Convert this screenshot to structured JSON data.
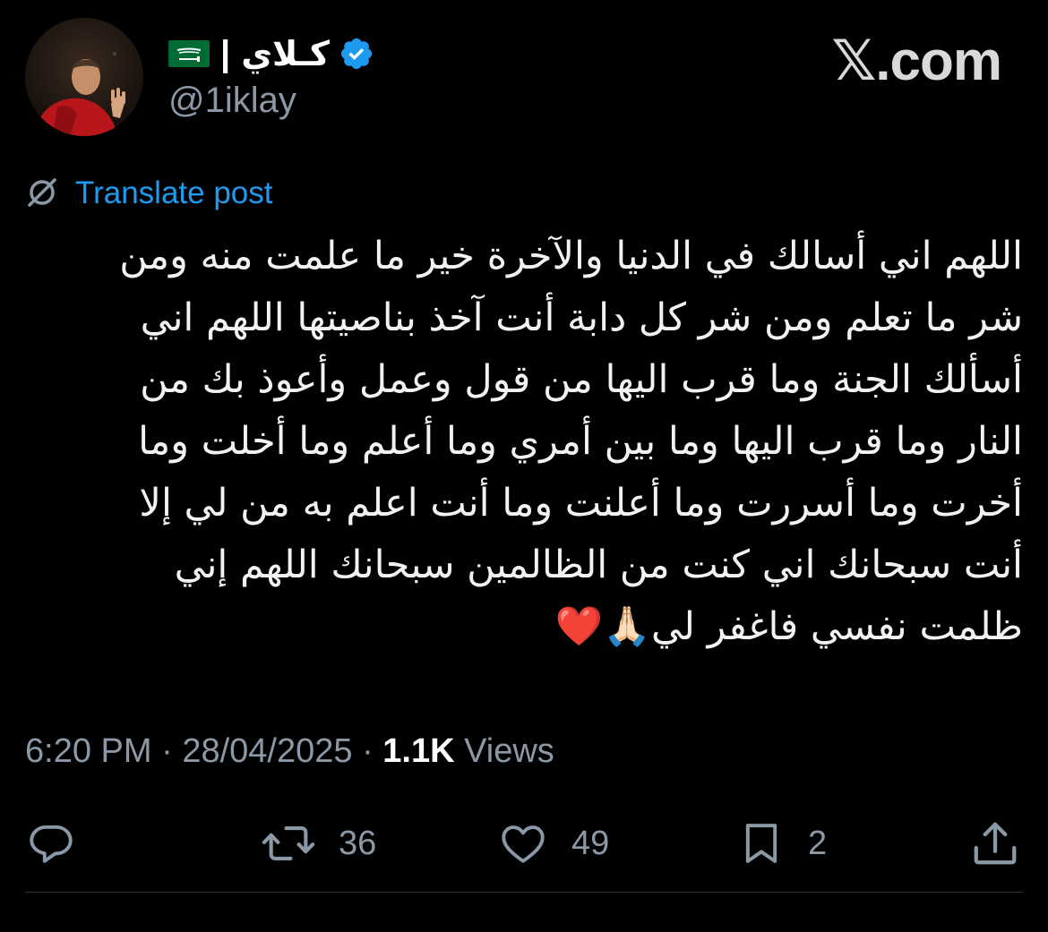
{
  "post": {
    "author": {
      "display_name": "كـلاي",
      "separator": "|",
      "handle": "@1iklay",
      "verified": true,
      "flag_icon": "saudi-flag-icon",
      "verified_icon": "verified-badge-icon"
    },
    "brand": "𝕏.com",
    "translate_label": "Translate post",
    "text": "اللهم اني أسالك في الدنيا والآخرة خير ما علمت منه ومن\nشر ما تعلم ومن شر كل دابة أنت آخذ بناصيتها اللهم اني\nأسألك الجنة وما قرب اليها من قول وعمل وأعوذ بك من\nالنار وما قرب اليها وما بين أمري وما أعلم وما أخلت وما\nأخرت وما أسررت وما أعلنت وما أنت اعلم به من لي إلا\nأنت سبحانك اني كنت من الظالمين سبحانك اللهم إني\nظلمت نفسي فاغفر لي🙏🏻❤️",
    "meta": {
      "time": "6:20 PM",
      "dot": "·",
      "date": "28/04/2025",
      "views_count": "1.1K",
      "views_label": "Views"
    },
    "actions": {
      "reply_icon": "reply-icon",
      "repost_icon": "repost-icon",
      "repost_count": "36",
      "like_icon": "heart-icon",
      "like_count": "49",
      "bookmark_icon": "bookmark-icon",
      "bookmark_count": "2",
      "share_icon": "share-icon"
    },
    "colors": {
      "background": "#000000",
      "text": "#e7e9ea",
      "secondary": "#8b98a5",
      "link": "#1d9bf0",
      "verified": "#1d9bf0"
    }
  }
}
